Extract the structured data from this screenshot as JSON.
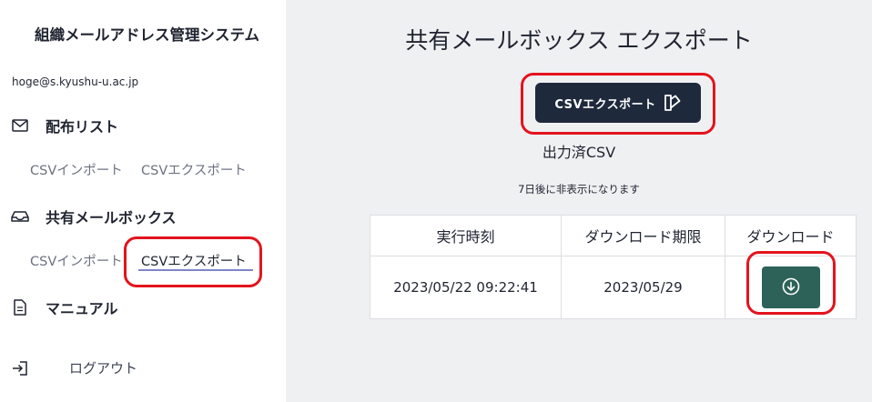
{
  "sidebar": {
    "app_title": "組織メールアドレス管理システム",
    "user_email": "hoge@s.kyushu-u.ac.jp",
    "sections": [
      {
        "label": "配布リスト",
        "icon": "envelope-icon",
        "items": [
          "CSVインポート",
          "CSVエクスポート"
        ]
      },
      {
        "label": "共有メールボックス",
        "icon": "inbox-icon",
        "items": [
          "CSVインポート",
          "CSVエクスポート"
        ],
        "active_item": "CSVエクスポート"
      },
      {
        "label": "マニュアル",
        "icon": "document-icon",
        "items": []
      }
    ],
    "logout_label": "ログアウト"
  },
  "main": {
    "title": "共有メールボックス エクスポート",
    "export_button_label": "CSVエクスポート",
    "output_title": "出力済CSV",
    "output_note": "7日後に非表示になります",
    "table": {
      "headers": [
        "実行時刻",
        "ダウンロード期限",
        "ダウンロード"
      ],
      "rows": [
        {
          "executed_at": "2023/05/22 09:22:41",
          "expires": "2023/05/29"
        }
      ]
    }
  },
  "colors": {
    "sidebar_bg": "#ffffff",
    "main_bg": "#eff0f2",
    "export_button_bg": "#1e2a3c",
    "download_button_bg": "#2d6258",
    "highlight": "#e3141c",
    "active_underline": "#7f86c9"
  }
}
